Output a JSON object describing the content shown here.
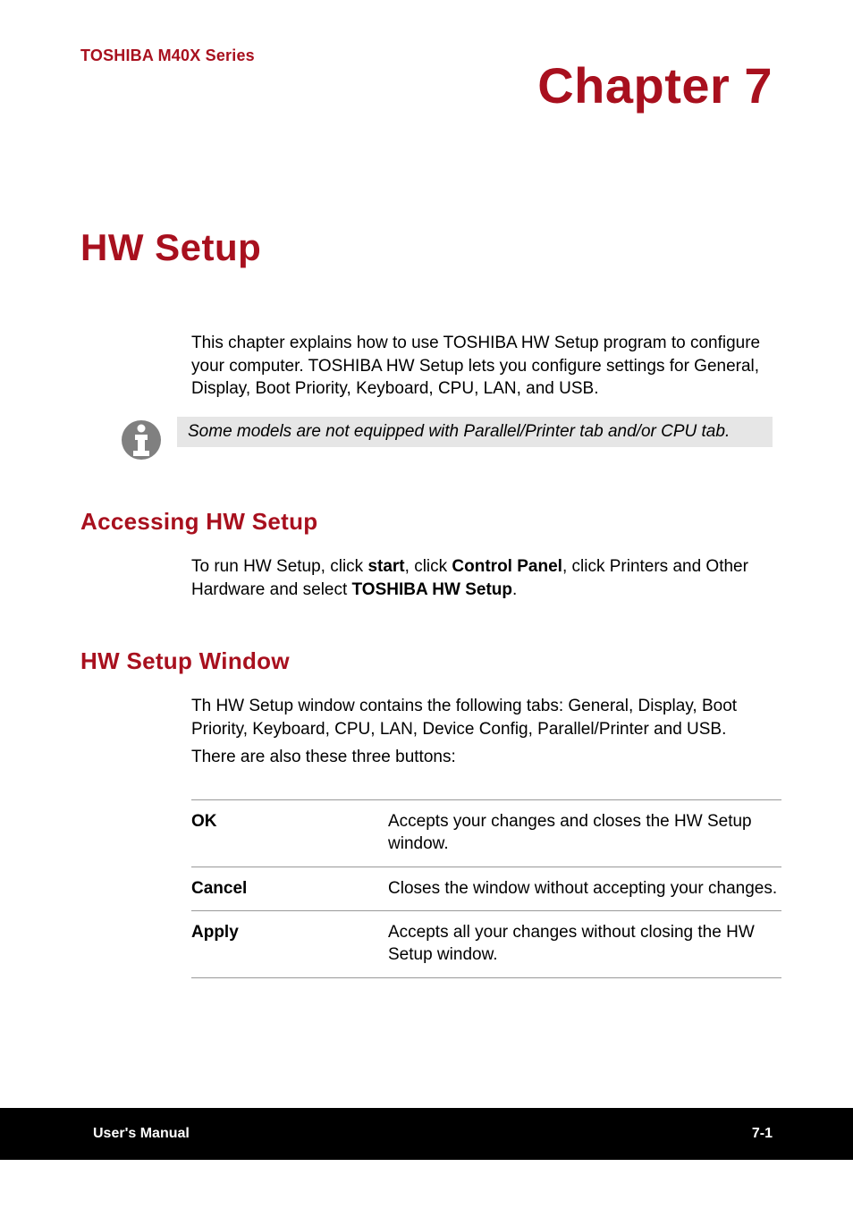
{
  "header": {
    "series": "TOSHIBA M40X Series",
    "chapter": "Chapter 7"
  },
  "title": "HW Setup",
  "intro": "This chapter explains how to use TOSHIBA HW Setup program to configure your computer. TOSHIBA HW Setup lets you configure settings for General, Display, Boot Priority, Keyboard, CPU, LAN, and USB.",
  "note": "Some models are not equipped with Parallel/Printer tab and/or CPU tab.",
  "sections": {
    "accessing": {
      "heading": "Accessing HW Setup",
      "body_pre": "To run HW Setup, click ",
      "bold1": "start",
      "mid1": ", click ",
      "bold2": "Control Panel",
      "mid2": ", click Printers and Other Hardware and select ",
      "bold3": "TOSHIBA HW Setup",
      "end": "."
    },
    "window": {
      "heading": "HW Setup Window",
      "body1": "Th HW Setup window contains the following tabs: General, Display, Boot Priority, Keyboard, CPU, LAN, Device Config, Parallel/Printer and USB.",
      "body2": "There are also these three buttons:",
      "buttons": [
        {
          "name": "OK",
          "desc": "Accepts your changes and closes the HW Setup window."
        },
        {
          "name": "Cancel",
          "desc": "Closes the window without accepting your changes."
        },
        {
          "name": "Apply",
          "desc": "Accepts all your changes without closing the HW Setup window."
        }
      ]
    }
  },
  "footer": {
    "left": "User's Manual",
    "right": "7-1"
  }
}
